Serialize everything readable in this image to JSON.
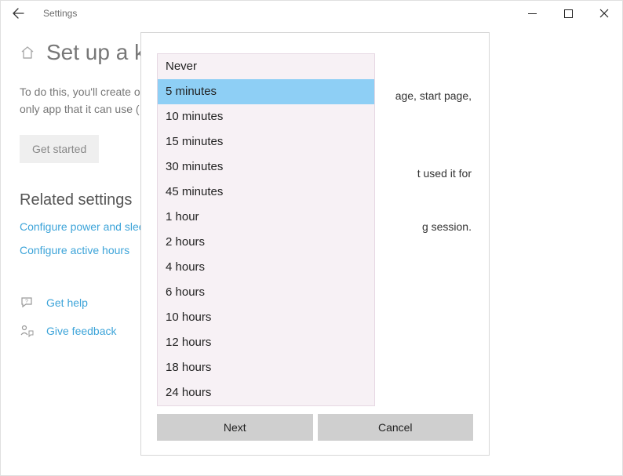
{
  "window": {
    "title": "Settings"
  },
  "page": {
    "title": "Set up a kiosk",
    "description_line1": "To do this, you'll create or choose an account that will be limited to",
    "description_line2": "only app that it can use (",
    "get_started_label": "Get started"
  },
  "related": {
    "heading": "Related settings",
    "link_power": "Configure power and sleep",
    "link_active_hours": "Configure active hours"
  },
  "help": {
    "get_help": "Get help",
    "give_feedback": "Give feedback"
  },
  "dialog": {
    "bg_text_1": "age, start page,",
    "bg_text_2": "t used it for",
    "bg_text_3": "g session.",
    "options": [
      "Never",
      "5 minutes",
      "10 minutes",
      "15 minutes",
      "30 minutes",
      "45 minutes",
      "1 hour",
      "2 hours",
      "4 hours",
      "6 hours",
      "10 hours",
      "12 hours",
      "18 hours",
      "24 hours"
    ],
    "selected_index": 1,
    "next_label": "Next",
    "cancel_label": "Cancel"
  }
}
